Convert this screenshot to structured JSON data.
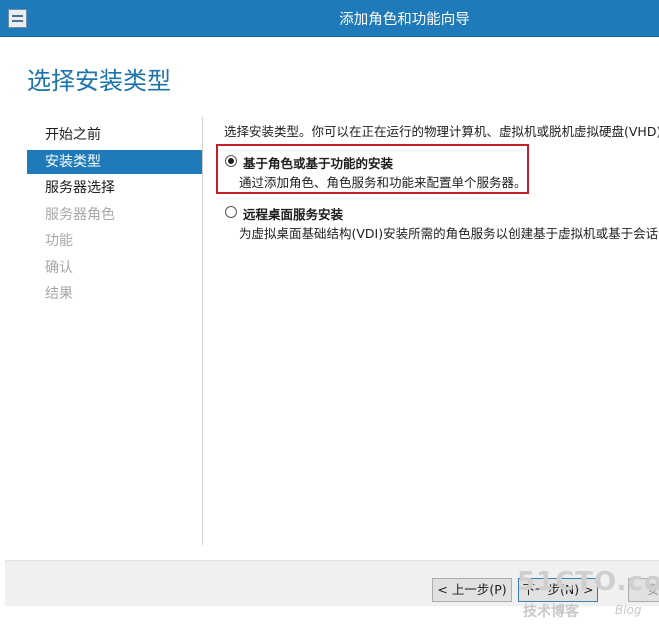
{
  "window": {
    "title": "添加角色和功能向导"
  },
  "page": {
    "title": "选择安装类型"
  },
  "steps": [
    {
      "label": "开始之前",
      "state": "normal"
    },
    {
      "label": "安装类型",
      "state": "active"
    },
    {
      "label": "服务器选择",
      "state": "normal"
    },
    {
      "label": "服务器角色",
      "state": "disabled"
    },
    {
      "label": "功能",
      "state": "disabled"
    },
    {
      "label": "确认",
      "state": "disabled"
    },
    {
      "label": "结果",
      "state": "disabled"
    }
  ],
  "content": {
    "description": "选择安装类型。你可以在正在运行的物理计算机、虚拟机或脱机虚拟硬盘(VHD)上安装角色和功能。",
    "options": [
      {
        "label": "基于角色或基于功能的安装",
        "description": "通过添加角色、角色服务和功能来配置单个服务器。",
        "selected": true
      },
      {
        "label": "远程桌面服务安装",
        "description": "为虚拟桌面基础结构(VDI)安装所需的角色服务以创建基于虚拟机或基于会话的桌面部署。",
        "selected": false
      }
    ]
  },
  "footer": {
    "prev_label": "< 上一步(P)",
    "next_label": "下一步(N) >",
    "install_label": "安"
  },
  "watermark": {
    "main": "51CTO.com",
    "sub": "技术博客",
    "blog": "Blog"
  },
  "colors": {
    "accent": "#1e7ab8",
    "highlight": "#c3202a"
  }
}
